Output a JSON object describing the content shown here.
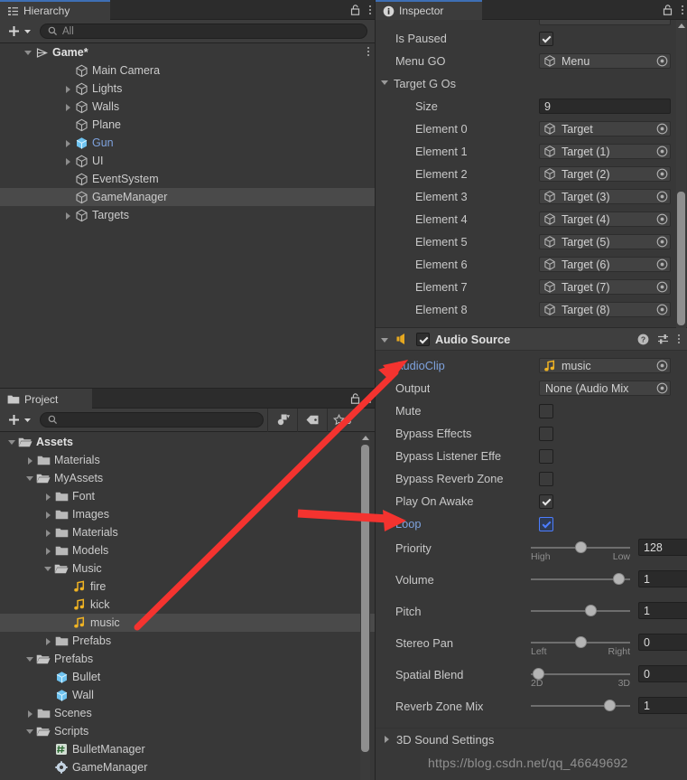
{
  "hierarchy": {
    "tab_label": "Hierarchy",
    "tab_icon": "hierarchy-icon",
    "add_label": "+",
    "search": {
      "value": "All",
      "placeholder": "All"
    },
    "items": [
      {
        "label": "Game*",
        "depth": 0,
        "fold": "down",
        "icon": "scene-icon",
        "selected": false,
        "style": "scene"
      },
      {
        "label": "Main Camera",
        "depth": 2,
        "fold": "none",
        "icon": "gameobject-icon",
        "selected": false,
        "style": "normal"
      },
      {
        "label": "Lights",
        "depth": 2,
        "fold": "right",
        "icon": "gameobject-icon",
        "selected": false,
        "style": "normal"
      },
      {
        "label": "Walls",
        "depth": 2,
        "fold": "right",
        "icon": "gameobject-icon",
        "selected": false,
        "style": "normal"
      },
      {
        "label": "Plane",
        "depth": 2,
        "fold": "none",
        "icon": "gameobject-icon",
        "selected": false,
        "style": "normal"
      },
      {
        "label": "Gun",
        "depth": 2,
        "fold": "right",
        "icon": "prefab-icon",
        "selected": false,
        "style": "prefab"
      },
      {
        "label": "UI",
        "depth": 2,
        "fold": "right",
        "icon": "gameobject-icon",
        "selected": false,
        "style": "normal"
      },
      {
        "label": "EventSystem",
        "depth": 2,
        "fold": "none",
        "icon": "gameobject-icon",
        "selected": false,
        "style": "normal"
      },
      {
        "label": "GameManager",
        "depth": 2,
        "fold": "none",
        "icon": "gameobject-icon",
        "selected": true,
        "style": "normal"
      },
      {
        "label": "Targets",
        "depth": 2,
        "fold": "right",
        "icon": "gameobject-icon",
        "selected": false,
        "style": "normal"
      }
    ]
  },
  "project": {
    "tab_label": "Project",
    "tab_icon": "folder-icon",
    "add_label": "+",
    "search": {
      "value": "",
      "placeholder": ""
    },
    "tools": [
      {
        "name": "asset-filter-icon",
        "label": ""
      },
      {
        "name": "label-filter-icon",
        "label": ""
      },
      {
        "name": "favorites-icon",
        "label": "8"
      }
    ],
    "items": [
      {
        "label": "Assets",
        "depth": 0,
        "fold": "down",
        "icon": "folder-open-icon",
        "selected": false
      },
      {
        "label": "Materials",
        "depth": 1,
        "fold": "right",
        "icon": "folder-icon",
        "selected": false
      },
      {
        "label": "MyAssets",
        "depth": 1,
        "fold": "down",
        "icon": "folder-open-icon",
        "selected": false
      },
      {
        "label": "Font",
        "depth": 2,
        "fold": "right",
        "icon": "folder-icon",
        "selected": false
      },
      {
        "label": "Images",
        "depth": 2,
        "fold": "right",
        "icon": "folder-icon",
        "selected": false
      },
      {
        "label": "Materials",
        "depth": 2,
        "fold": "right",
        "icon": "folder-icon",
        "selected": false
      },
      {
        "label": "Models",
        "depth": 2,
        "fold": "right",
        "icon": "folder-icon",
        "selected": false
      },
      {
        "label": "Music",
        "depth": 2,
        "fold": "down",
        "icon": "folder-open-icon",
        "selected": false
      },
      {
        "label": "fire",
        "depth": 3,
        "fold": "none",
        "icon": "audioclip-icon",
        "selected": false
      },
      {
        "label": "kick",
        "depth": 3,
        "fold": "none",
        "icon": "audioclip-icon",
        "selected": false
      },
      {
        "label": "music",
        "depth": 3,
        "fold": "none",
        "icon": "audioclip-icon",
        "selected": true
      },
      {
        "label": "Prefabs",
        "depth": 2,
        "fold": "right",
        "icon": "folder-icon",
        "selected": false
      },
      {
        "label": "Prefabs",
        "depth": 1,
        "fold": "down",
        "icon": "folder-open-icon",
        "selected": false
      },
      {
        "label": "Bullet",
        "depth": 2,
        "fold": "none",
        "icon": "prefab-icon",
        "selected": false
      },
      {
        "label": "Wall",
        "depth": 2,
        "fold": "none",
        "icon": "prefab-icon",
        "selected": false
      },
      {
        "label": "Scenes",
        "depth": 1,
        "fold": "right",
        "icon": "folder-icon",
        "selected": false
      },
      {
        "label": "Scripts",
        "depth": 1,
        "fold": "down",
        "icon": "folder-open-icon",
        "selected": false
      },
      {
        "label": "BulletManager",
        "depth": 2,
        "fold": "none",
        "icon": "cs-script-icon",
        "selected": false
      },
      {
        "label": "GameManager",
        "depth": 2,
        "fold": "none",
        "icon": "gear-script-icon",
        "selected": false
      }
    ]
  },
  "inspector": {
    "tab_label": "Inspector",
    "tab_icon": "info-icon",
    "script_rows": [
      {
        "name": "Is Paused",
        "type": "checkbox",
        "value": true
      },
      {
        "name": "Menu GO",
        "type": "object",
        "value": "Menu",
        "icon": "gameobject-icon"
      },
      {
        "name": "Target G Os",
        "type": "foldout",
        "value": ""
      },
      {
        "name": "Size",
        "type": "number",
        "value": "9"
      },
      {
        "name": "Element 0",
        "type": "object",
        "value": "Target",
        "icon": "gameobject-icon"
      },
      {
        "name": "Element 1",
        "type": "object",
        "value": "Target (1)",
        "icon": "gameobject-icon"
      },
      {
        "name": "Element 2",
        "type": "object",
        "value": "Target (2)",
        "icon": "gameobject-icon"
      },
      {
        "name": "Element 3",
        "type": "object",
        "value": "Target (3)",
        "icon": "gameobject-icon"
      },
      {
        "name": "Element 4",
        "type": "object",
        "value": "Target (4)",
        "icon": "gameobject-icon"
      },
      {
        "name": "Element 5",
        "type": "object",
        "value": "Target (5)",
        "icon": "gameobject-icon"
      },
      {
        "name": "Element 6",
        "type": "object",
        "value": "Target (6)",
        "icon": "gameobject-icon"
      },
      {
        "name": "Element 7",
        "type": "object",
        "value": "Target (7)",
        "icon": "gameobject-icon"
      },
      {
        "name": "Element 8",
        "type": "object",
        "value": "Target (8)",
        "icon": "gameobject-icon"
      }
    ],
    "audio_source": {
      "title": "Audio Source",
      "enabled": true,
      "icon": "audio-source-icon",
      "help_icon": "help-icon",
      "preset_icon": "preset-icon",
      "menu_icon": "kebab-menu-icon",
      "rows": [
        {
          "name": "AudioClip",
          "type": "object",
          "value": "music",
          "icon": "audioclip-icon",
          "highlight": true
        },
        {
          "name": "Output",
          "type": "object",
          "value": "None (Audio Mix",
          "icon": "none"
        },
        {
          "name": "Mute",
          "type": "checkbox",
          "value": false
        },
        {
          "name": "Bypass Effects",
          "type": "checkbox",
          "value": false
        },
        {
          "name": "Bypass Listener Effe",
          "type": "checkbox",
          "value": false
        },
        {
          "name": "Bypass Reverb Zone",
          "type": "checkbox",
          "value": false
        },
        {
          "name": "Play On Awake",
          "type": "checkbox",
          "value": true
        },
        {
          "name": "Loop",
          "type": "checkbox",
          "value": true,
          "highlight": true,
          "focused": true
        }
      ],
      "sliders": [
        {
          "name": "Priority",
          "value": "128",
          "pos": 0.5,
          "left_label": "High",
          "right_label": "Low"
        },
        {
          "name": "Volume",
          "value": "1",
          "pos": 0.94,
          "left_label": "",
          "right_label": ""
        },
        {
          "name": "Pitch",
          "value": "1",
          "pos": 0.62,
          "left_label": "",
          "right_label": ""
        },
        {
          "name": "Stereo Pan",
          "value": "0",
          "pos": 0.5,
          "left_label": "Left",
          "right_label": "Right"
        },
        {
          "name": "Spatial Blend",
          "value": "0",
          "pos": 0.02,
          "left_label": "2D",
          "right_label": "3D"
        },
        {
          "name": "Reverb Zone Mix",
          "value": "1",
          "pos": 0.84,
          "left_label": "",
          "right_label": ""
        }
      ],
      "footer_foldout": "3D Sound Settings"
    }
  },
  "watermark": {
    "text": "https://blog.csdn.net/qq_46649692"
  },
  "colors": {
    "panel_bg": "#383838",
    "tab_bg": "#3c3c3c",
    "strip_bg": "#2c2c2c",
    "selection": "#4a4a4a",
    "accent_blue": "#3e6fb5",
    "prefab_blue": "#7ea2dd",
    "audio_yellow": "#e6a820",
    "arrow_red": "#f4332f",
    "focus_blue": "#4c7eff"
  }
}
